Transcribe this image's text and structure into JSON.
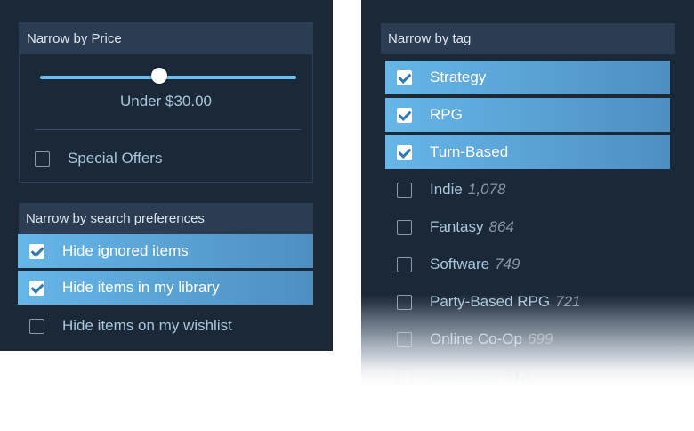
{
  "price": {
    "header": "Narrow by Price",
    "slider_value_label": "Under $30.00",
    "slider_fraction": 0.47,
    "special_offers": {
      "label": "Special Offers",
      "checked": false
    }
  },
  "preferences": {
    "header": "Narrow by search preferences",
    "items": [
      {
        "label": "Hide ignored items",
        "checked": true
      },
      {
        "label": "Hide items in my library",
        "checked": true
      },
      {
        "label": "Hide items on my wishlist",
        "checked": false
      }
    ]
  },
  "tags": {
    "header": "Narrow by tag",
    "items": [
      {
        "label": "Strategy",
        "count": "",
        "checked": true
      },
      {
        "label": "RPG",
        "count": "",
        "checked": true
      },
      {
        "label": "Turn-Based",
        "count": "",
        "checked": true
      },
      {
        "label": "Indie",
        "count": "1,078",
        "checked": false
      },
      {
        "label": "Fantasy",
        "count": "864",
        "checked": false
      },
      {
        "label": "Software",
        "count": "749",
        "checked": false
      },
      {
        "label": "Party-Based RPG",
        "count": "721",
        "checked": false
      },
      {
        "label": "Online Co-Op",
        "count": "699",
        "checked": false
      },
      {
        "label": "Adventure",
        "count": "612",
        "checked": false
      }
    ]
  },
  "colors": {
    "panel_bg": "#1b2838",
    "header_bg": "#2b3c53",
    "accent": "#67c1f5",
    "selected_start": "#66b6e8",
    "selected_end": "#4e8fc2"
  }
}
